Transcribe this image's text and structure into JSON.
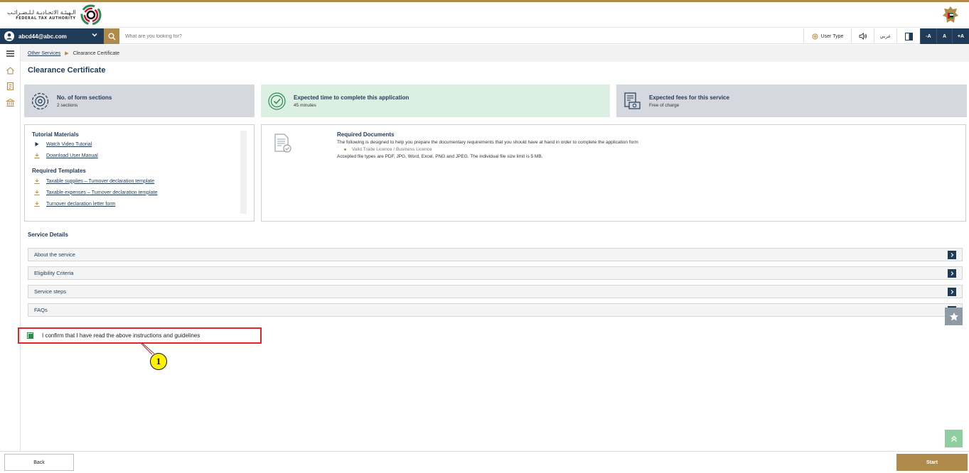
{
  "header": {
    "logo_arabic": "الـهيئـة الاتحـاديـة لـلـضـرائـب",
    "logo_english": "FEDERAL TAX AUTHORITY"
  },
  "toolbar": {
    "user_email": "abcd44@abc.com",
    "search_placeholder": "What are you looking for?",
    "user_type_label": "User Type",
    "arabic_label": "عربي",
    "font_decrease": "-A",
    "font_normal": "A",
    "font_increase": "+A"
  },
  "breadcrumb": {
    "parent": "Other Services",
    "current": "Clearance Certificate"
  },
  "page": {
    "title": "Clearance Certificate"
  },
  "cards": [
    {
      "title": "No. of form sections",
      "subtitle": "2 sections"
    },
    {
      "title": "Expected time to complete this application",
      "subtitle": "45 minutes"
    },
    {
      "title": "Expected fees for this service",
      "subtitle": "Free of charge"
    }
  ],
  "tutorial": {
    "heading": "Tutorial Materials",
    "links": [
      "Watch Video Tutorial",
      "Download User Manual"
    ],
    "templates_heading": "Required Templates",
    "templates": [
      "Taxable supplies – Turnover declaration template",
      "Taxable expenses – Turnover declaration template",
      "Turnover declaration letter form"
    ]
  },
  "required_documents": {
    "heading": "Required Documents",
    "intro": "The following is designed to help you prepare the documentary requirements that you should have at hand in order to complete the application form",
    "items": [
      "Valid Trade Licence / Business Licence"
    ],
    "note": "Accepted file types are PDF, JPG, Word, Excel, PNG and JPEG. The individual file size limit is 5 MB."
  },
  "service_details": {
    "heading": "Service Details",
    "sections": [
      "About the service",
      "Eligibility Criteria",
      "Service steps",
      "FAQs"
    ]
  },
  "confirm": {
    "label": "I confirm that I have read the above instructions and guidelines",
    "checked": true
  },
  "callout": {
    "number": "1"
  },
  "footer": {
    "back_label": "Back",
    "start_label": "Start"
  },
  "colors": {
    "brand_navy": "#1f3b57",
    "brand_gold": "#b08a4a",
    "highlight_red": "#e0262b",
    "check_green": "#2d8a4e"
  }
}
